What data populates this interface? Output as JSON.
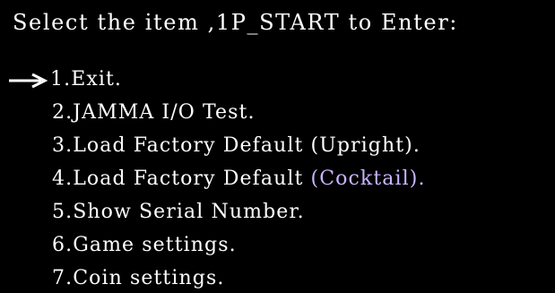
{
  "header": {
    "text": "Select the item ,1P_START to Enter:"
  },
  "cursor": {
    "icon": "arrow-right-icon",
    "selected_index": 0
  },
  "menu": {
    "items": [
      {
        "label": "1.Exit."
      },
      {
        "label": "2.JAMMA I/O Test."
      },
      {
        "label": "3.Load Factory Default (Upright)."
      },
      {
        "label": "4.Load Factory Default (Cocktail)."
      },
      {
        "label": "5.Show Serial Number."
      },
      {
        "label": "6.Game settings."
      },
      {
        "label": "7.Coin settings."
      }
    ]
  },
  "colors": {
    "background": "#000000",
    "text": "#ffffff",
    "cocktail_text": "#c9b5ff"
  }
}
